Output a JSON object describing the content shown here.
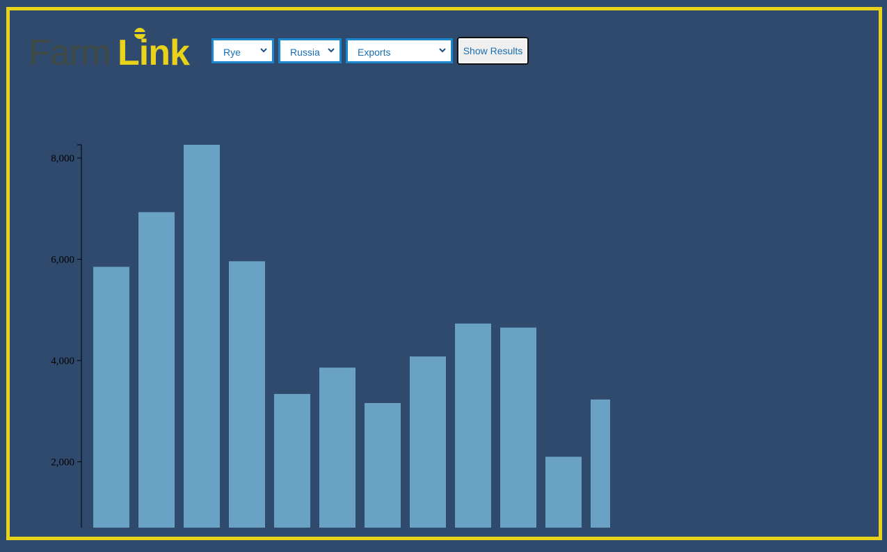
{
  "brand": {
    "part1": "Farm",
    "part2": "Link"
  },
  "controls": {
    "crop": "Rye",
    "country": "Russia",
    "metric": "Exports",
    "button": "Show Results"
  },
  "colors": {
    "background": "#304a6e",
    "frame": "#e8d21a",
    "bar": "#6aa2c6",
    "accent": "#1a86d0"
  },
  "chart_data": {
    "type": "bar",
    "title": "",
    "xlabel": "",
    "ylabel": "",
    "grid": false,
    "y_ticks": [
      "2,000",
      "4,000",
      "6,000",
      "8,000"
    ],
    "y_tick_values": [
      2000,
      4000,
      6000,
      8000
    ],
    "ylim": [
      700,
      8260
    ],
    "categories": [
      "",
      "",
      "",
      "",
      "",
      "",
      "",
      "",
      "",
      "",
      "",
      ""
    ],
    "values": [
      5850,
      6930,
      8260,
      5960,
      3340,
      3860,
      3160,
      4080,
      4730,
      4650,
      2100,
      3230
    ]
  }
}
